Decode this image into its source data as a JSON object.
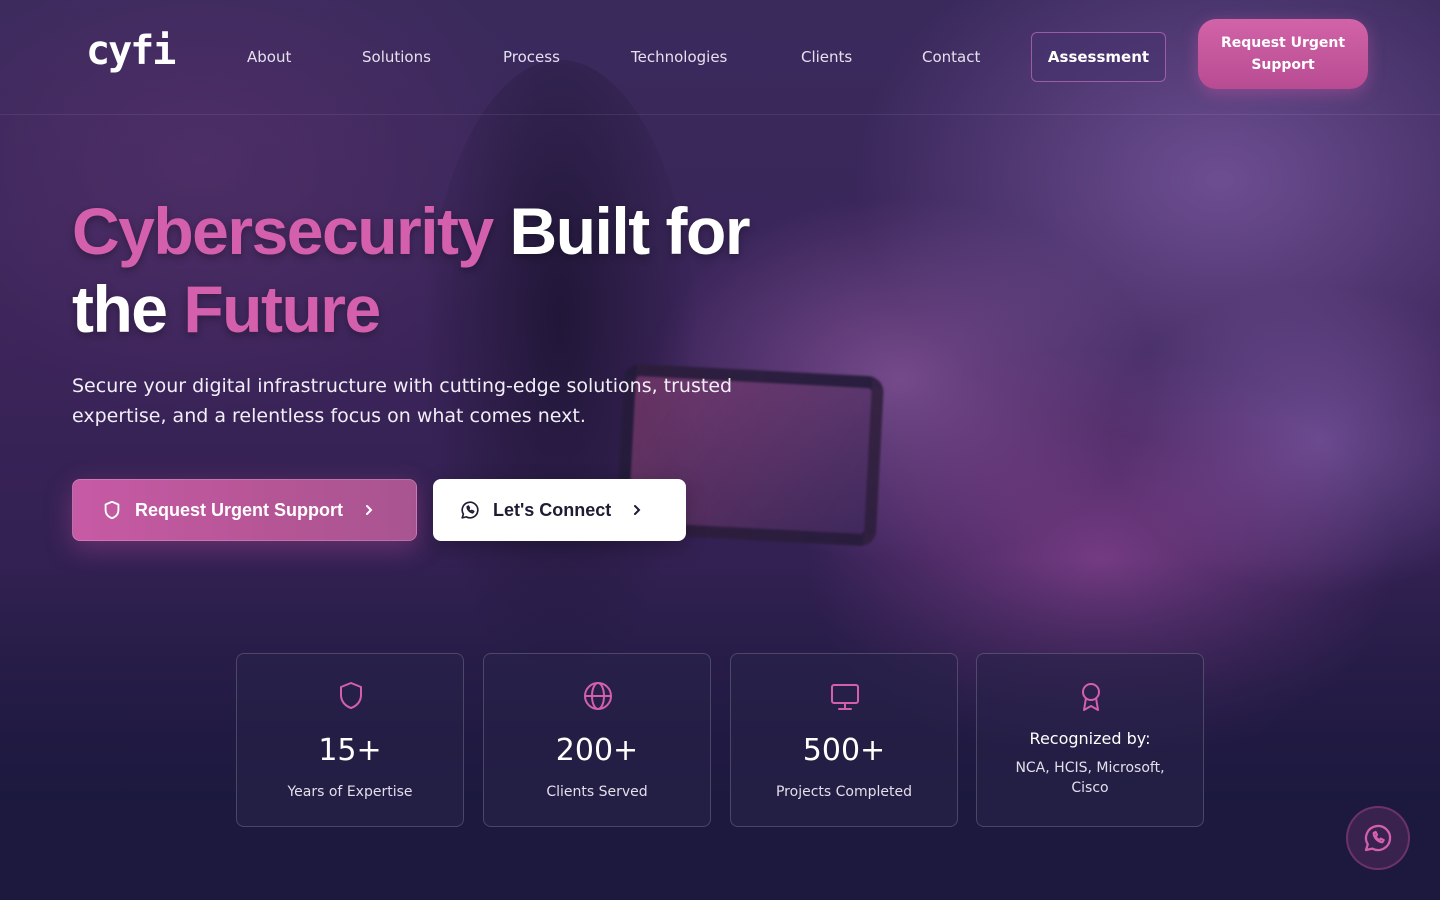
{
  "brand": {
    "logo_text": "cyfi"
  },
  "nav": {
    "links": [
      "About",
      "Solutions",
      "Process",
      "Technologies",
      "Clients",
      "Contact"
    ],
    "assessment_label": "Assessment",
    "urgent_label": "Request Urgent Support"
  },
  "hero": {
    "title_part1": "Cybersecurity",
    "title_part2": " Built for",
    "title_part3": "the ",
    "title_part4": "Future",
    "subtitle": "Secure your digital infrastructure with cutting-edge solutions, trusted expertise, and a relentless focus on what comes next.",
    "primary_button": "Request Urgent Support",
    "secondary_button": "Let's Connect"
  },
  "stats": [
    {
      "icon": "shield-icon",
      "value": "15+",
      "label": "Years of Expertise"
    },
    {
      "icon": "globe-icon",
      "value": "200+",
      "label": "Clients Served"
    },
    {
      "icon": "monitor-icon",
      "value": "500+",
      "label": "Projects Completed"
    },
    {
      "icon": "award-icon",
      "title": "Recognized by:",
      "label": "NCA, HCIS, Microsoft, Cisco"
    }
  ],
  "colors": {
    "accent": "#d460ad",
    "button_pink": "#c75aa5",
    "background": "#241a45"
  }
}
